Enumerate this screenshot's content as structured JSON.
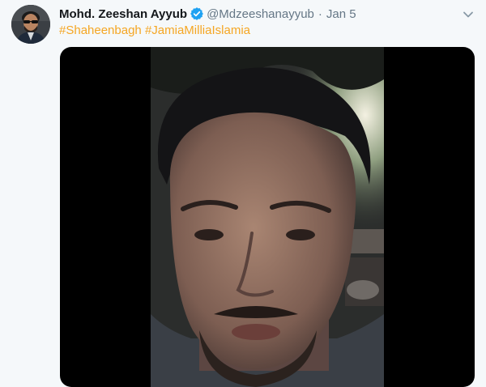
{
  "tweet": {
    "author_name": "Mohd. Zeeshan Ayyub",
    "handle": "@Mdzeeshanayyub",
    "separator": "·",
    "date": "Jan 5",
    "hashtags": [
      "#Shaheenbagh",
      "#JamiaMilliaIslamia"
    ]
  },
  "colors": {
    "hashtag": "#f5a623",
    "verified_badge": "#1da1f2",
    "background": "#f5f8fa"
  },
  "icons": {
    "verified": "verified-badge-icon",
    "caret": "chevron-down-icon"
  }
}
